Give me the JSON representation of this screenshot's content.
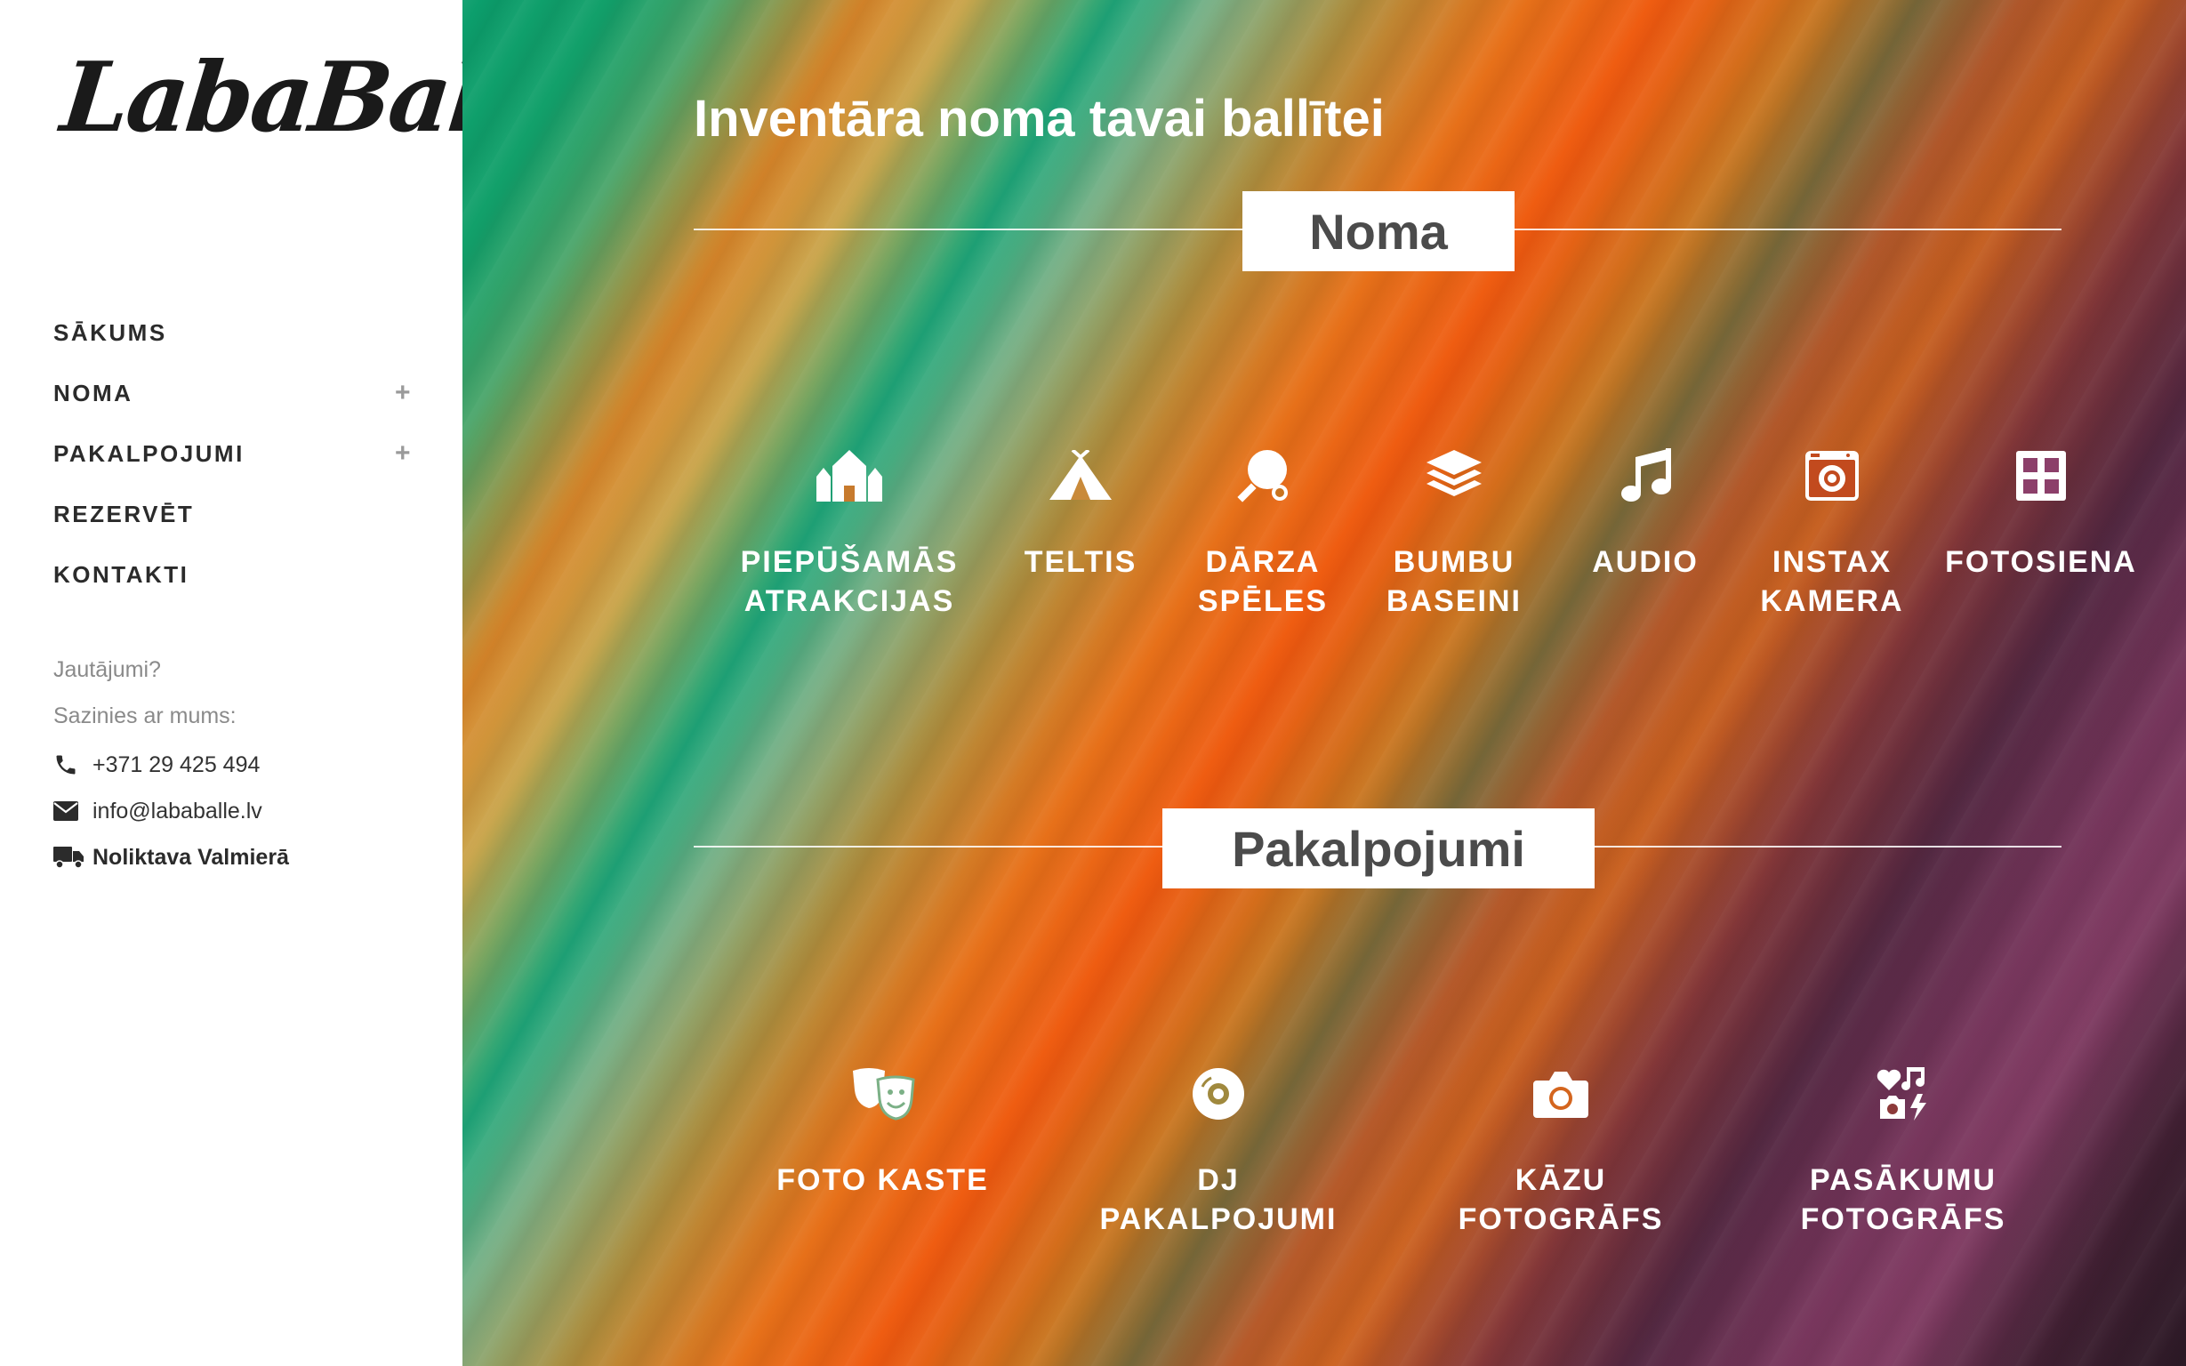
{
  "brand": {
    "logo_text": "LabaBalle"
  },
  "nav": {
    "items": [
      {
        "label": "SĀKUMS",
        "has_submenu": false
      },
      {
        "label": "NOMA",
        "has_submenu": true,
        "expand_glyph": "+"
      },
      {
        "label": "PAKALPOJUMI",
        "has_submenu": true,
        "expand_glyph": "+"
      },
      {
        "label": "REZERVĒT",
        "has_submenu": false
      },
      {
        "label": "KONTAKTI",
        "has_submenu": false
      }
    ]
  },
  "contact": {
    "question": "Jautājumi?",
    "reach_us": "Sazinies ar mums:",
    "phone": {
      "icon": "phone-icon",
      "text": "+371 29 425 494"
    },
    "email": {
      "icon": "envelope-icon",
      "text": "info@lababalle.lv"
    },
    "warehouse": {
      "icon": "truck-icon",
      "text": "Noliktava Valmierā"
    }
  },
  "main": {
    "title": "Inventāra noma tavai ballītei",
    "rental_section": {
      "heading": "Noma",
      "items": [
        {
          "icon": "bouncy-castle-icon",
          "label": "PIEPŪŠAMĀS\nATRAKCIJAS"
        },
        {
          "icon": "tent-icon",
          "label": "TELTIS"
        },
        {
          "icon": "ping-pong-icon",
          "label": "DĀRZA\nSPĒLES"
        },
        {
          "icon": "layers-icon",
          "label": "BUMBU\nBASEINI"
        },
        {
          "icon": "music-note-icon",
          "label": "AUDIO"
        },
        {
          "icon": "instant-camera-icon",
          "label": "INSTAX\nKAMERA"
        },
        {
          "icon": "grid-icon",
          "label": "FOTOSIENA"
        }
      ]
    },
    "services_section": {
      "heading": "Pakalpojumi",
      "items": [
        {
          "icon": "theater-masks-icon",
          "label": "FOTO KASTE"
        },
        {
          "icon": "compact-disc-icon",
          "label": "DJ\nPAKALPOJUMI"
        },
        {
          "icon": "camera-icon",
          "label": "KĀZU\nFOTOGRĀFS"
        },
        {
          "icon": "icons-icon",
          "label": "PASĀKUMU\nFOTOGRĀFS"
        }
      ]
    }
  },
  "colors": {
    "sidebar_bg": "#ffffff",
    "nav_text": "#2b2b2b",
    "muted_text": "#8a8a8a",
    "section_heading_text": "#4b4b4b",
    "overlay_text": "#ffffff"
  }
}
